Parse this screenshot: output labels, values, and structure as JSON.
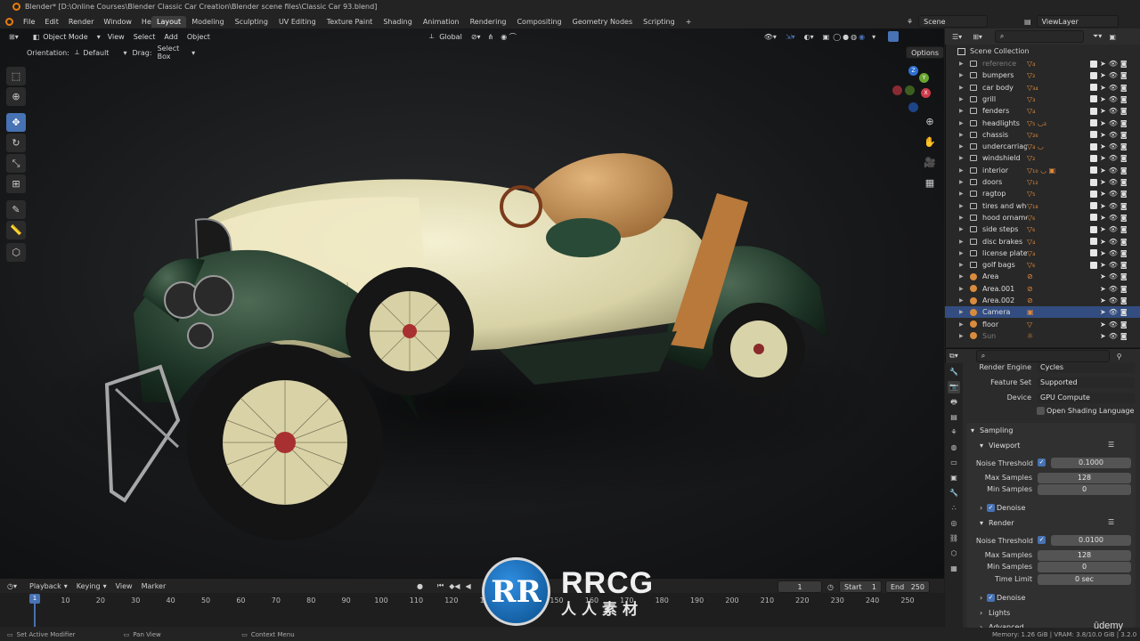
{
  "window": {
    "title": "Blender* [D:\\Online Courses\\Blender Classic Car Creation\\Blender scene files\\Classic Car 93.blend]"
  },
  "menus": [
    "File",
    "Edit",
    "Render",
    "Window",
    "Help"
  ],
  "workspaces": [
    "Layout",
    "Modeling",
    "Sculpting",
    "UV Editing",
    "Texture Paint",
    "Shading",
    "Animation",
    "Rendering",
    "Compositing",
    "Geometry Nodes",
    "Scripting"
  ],
  "scene": {
    "name": "Scene",
    "view_layer": "ViewLayer"
  },
  "viewport_header": {
    "mode": "Object Mode",
    "menus": [
      "View",
      "Select",
      "Add",
      "Object"
    ],
    "transform": "Global",
    "orientation_label": "Orientation:",
    "orientation_value": "Default",
    "drag_label": "Drag:",
    "drag_value": "Select Box",
    "options": "Options"
  },
  "gizmo": {
    "z": "Z",
    "y": "Y",
    "x": "X"
  },
  "outliner": {
    "root": "Scene Collection",
    "items": [
      {
        "name": "reference",
        "mod": "▽₄",
        "type": "coll",
        "dim": true
      },
      {
        "name": "bumpers",
        "mod": "▽₂",
        "type": "coll"
      },
      {
        "name": "car body",
        "mod": "▽₃₄",
        "type": "coll"
      },
      {
        "name": "grill",
        "mod": "▽₃",
        "type": "coll"
      },
      {
        "name": "fenders",
        "mod": "▽₄",
        "type": "coll"
      },
      {
        "name": "headlights",
        "mod": "▽₅ ◡₂",
        "type": "coll"
      },
      {
        "name": "chassis",
        "mod": "▽₂₆",
        "type": "coll"
      },
      {
        "name": "undercarriage",
        "mod": "▽₄ ◡",
        "type": "coll"
      },
      {
        "name": "windshield",
        "mod": "▽₂",
        "type": "coll"
      },
      {
        "name": "interior",
        "mod": "▽₁₀ ◡ ▣",
        "type": "coll"
      },
      {
        "name": "doors",
        "mod": "▽₁₂",
        "type": "coll"
      },
      {
        "name": "ragtop",
        "mod": "▽₅",
        "type": "coll"
      },
      {
        "name": "tires and wheels",
        "mod": "▽₁₈",
        "type": "coll"
      },
      {
        "name": "hood ornament",
        "mod": "▽₆",
        "type": "coll"
      },
      {
        "name": "side steps",
        "mod": "▽₆",
        "type": "coll"
      },
      {
        "name": "disc brakes",
        "mod": "▽₄",
        "type": "coll"
      },
      {
        "name": "license plate",
        "mod": "▽₄",
        "type": "coll"
      },
      {
        "name": "golf bags",
        "mod": "▽₆",
        "type": "coll"
      },
      {
        "name": "Area",
        "mod": "⊘",
        "type": "obj"
      },
      {
        "name": "Area.001",
        "mod": "⊘",
        "type": "obj"
      },
      {
        "name": "Area.002",
        "mod": "⊘",
        "type": "obj"
      },
      {
        "name": "Camera",
        "mod": "▣",
        "type": "obj",
        "sel": true
      },
      {
        "name": "floor",
        "mod": "▽",
        "type": "obj"
      },
      {
        "name": "Sun",
        "mod": "☼",
        "type": "obj",
        "dim": true
      }
    ]
  },
  "properties": {
    "render_engine_label": "Render Engine",
    "render_engine": "Cycles",
    "feature_set_label": "Feature Set",
    "feature_set": "Supported",
    "device_label": "Device",
    "device": "GPU Compute",
    "osl_label": "Open Shading Language",
    "sampling": "Sampling",
    "viewport": "Viewport",
    "vp_noise_label": "Noise Threshold",
    "vp_noise": "0.1000",
    "vp_max_label": "Max Samples",
    "vp_max": "128",
    "vp_min_label": "Min Samples",
    "vp_min": "0",
    "denoise_label": "Denoise",
    "render": "Render",
    "r_noise_label": "Noise Threshold",
    "r_noise": "0.0100",
    "r_max_label": "Max Samples",
    "r_max": "128",
    "r_min_label": "Min Samples",
    "r_min": "0",
    "time_limit_label": "Time Limit",
    "time_limit": "0 sec",
    "denoise2_label": "Denoise",
    "lights": "Lights",
    "advanced": "Advanced"
  },
  "timeline": {
    "menus": [
      "Playback",
      "Keying",
      "View",
      "Marker"
    ],
    "current_frame": "1",
    "start_label": "Start",
    "start": "1",
    "end_label": "End",
    "end": "250",
    "ticks": [
      10,
      20,
      30,
      40,
      50,
      60,
      70,
      80,
      90,
      100,
      110,
      120,
      130,
      140,
      150,
      160,
      170,
      180,
      190,
      200,
      210,
      220,
      230,
      240,
      250
    ]
  },
  "statusbar": {
    "left": "Set Active Modifier",
    "mid": "Pan View",
    "right": "Context Menu",
    "memory": "Memory: 1.26 GiB | VRAM: 3.8/10.0 GiB | 3.2.0"
  },
  "watermark": {
    "logo": "RR",
    "text": "RRCG",
    "sub": "人人素材"
  },
  "udemy": "ūdemy",
  "colors": {
    "accent": "#4772b3",
    "car_body": "#e8e3bf",
    "fender": "#1f3a2a",
    "leather": "#c9955a"
  }
}
